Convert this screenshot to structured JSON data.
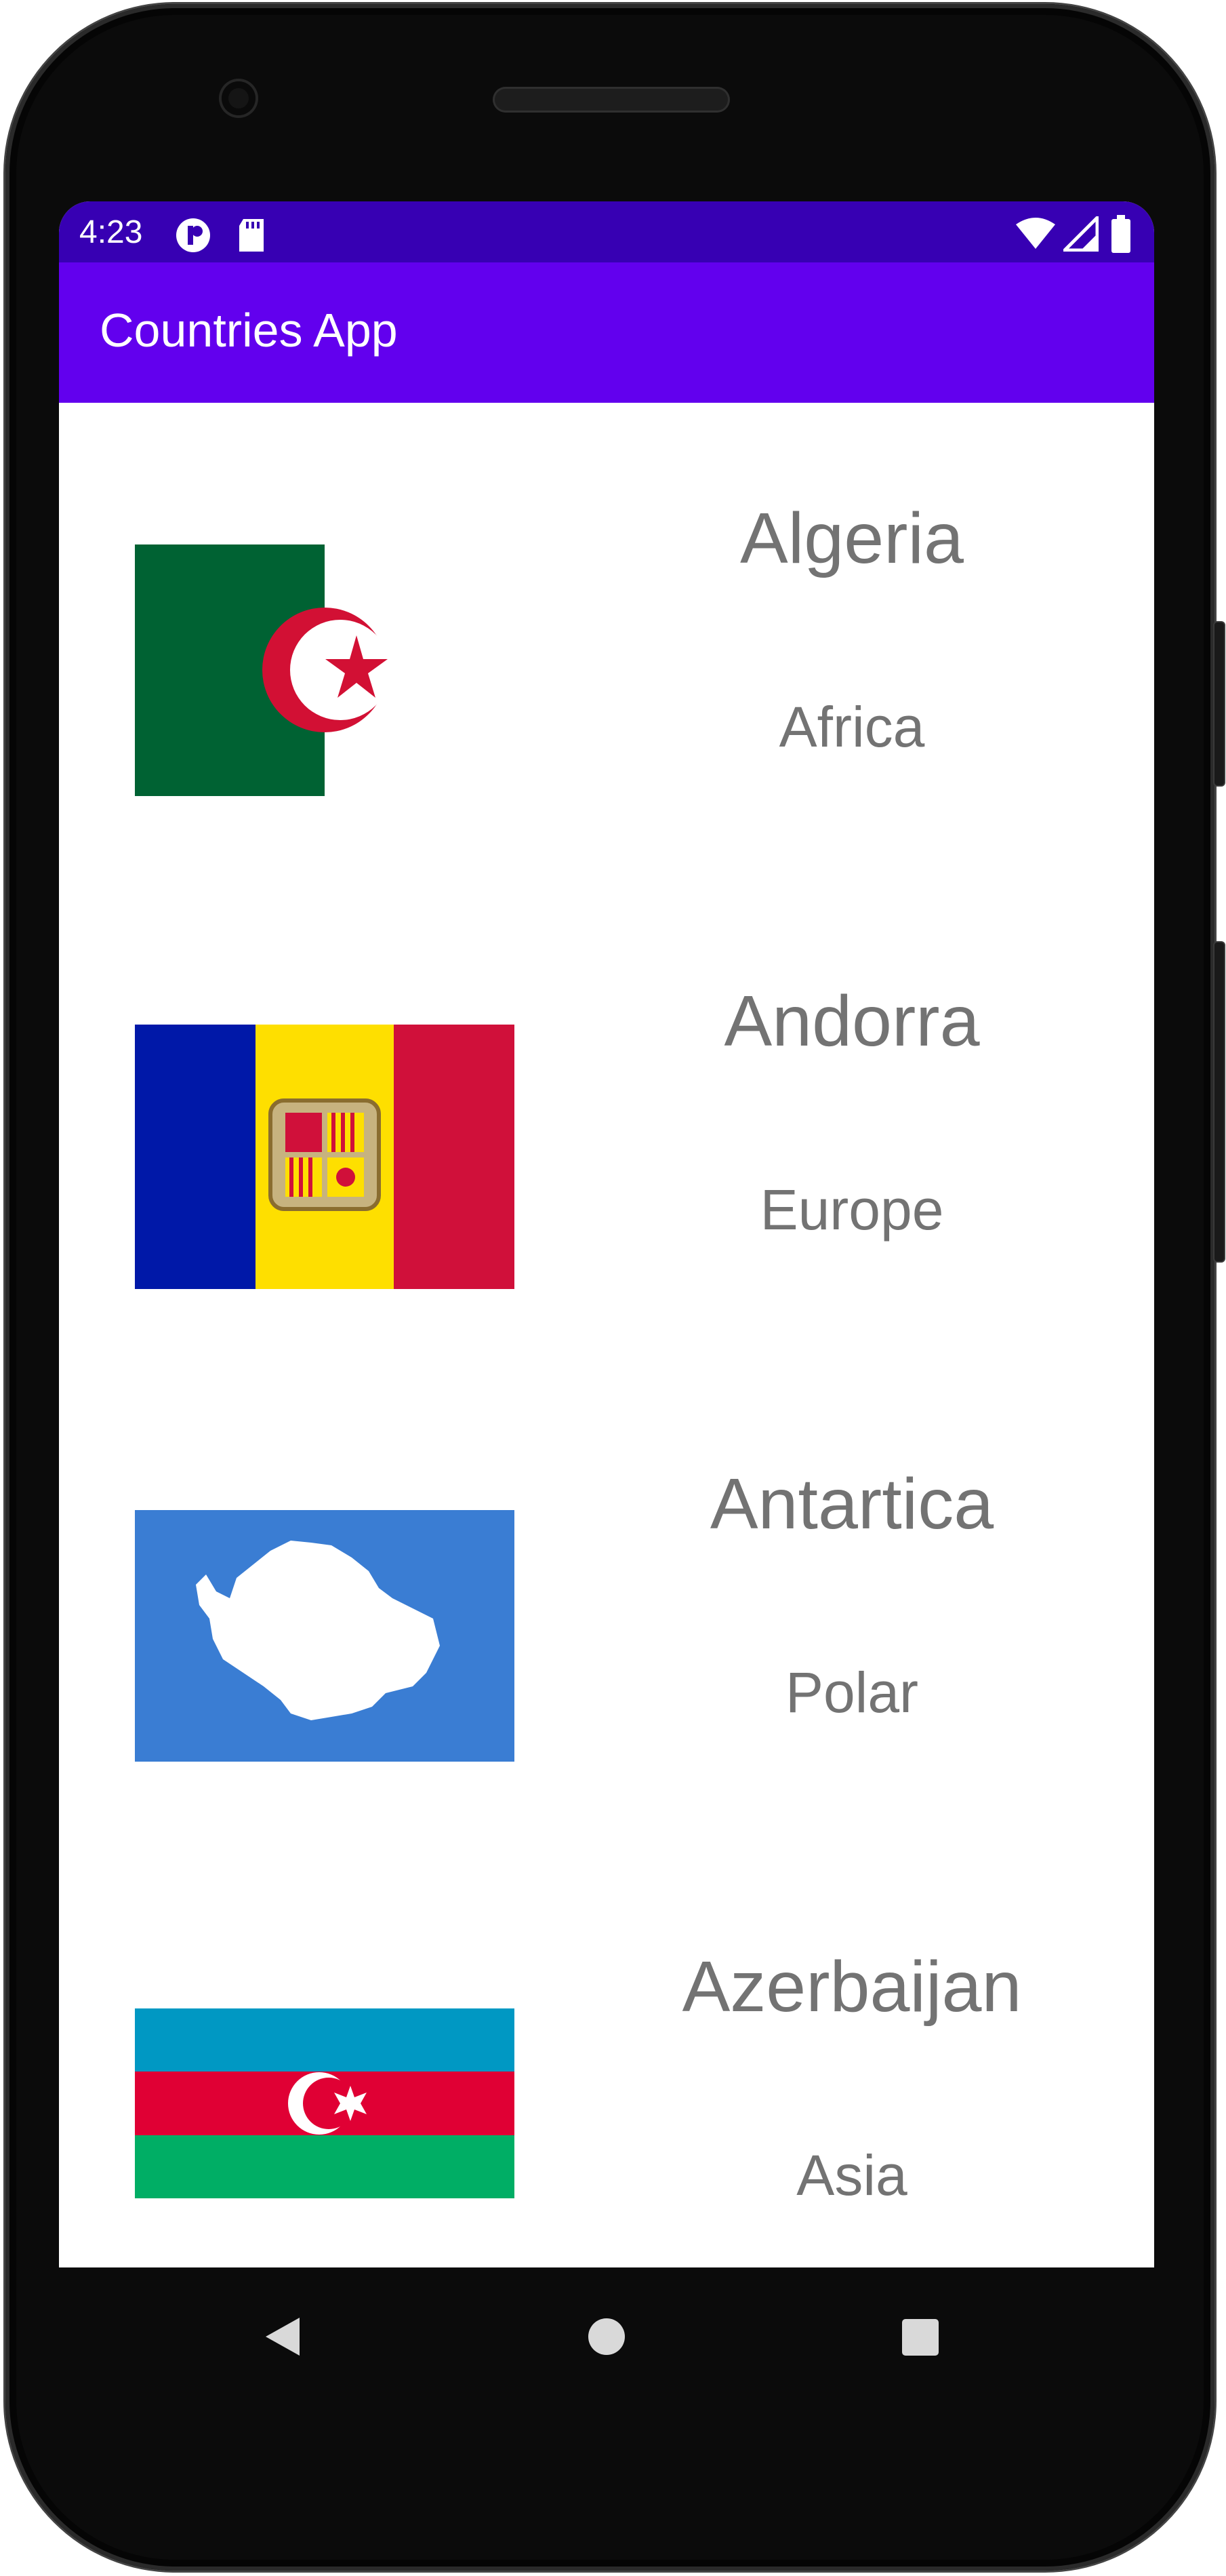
{
  "status_bar": {
    "time": "4:23",
    "bg_color": "#3700B3",
    "left_icons": [
      "notification-icon",
      "sd-card-icon"
    ],
    "right_icons": [
      "wifi-icon",
      "cellular-signal-icon",
      "battery-icon"
    ]
  },
  "app_bar": {
    "title": "Countries App",
    "bg_color": "#6200EE"
  },
  "countries": [
    {
      "name": "Algeria",
      "continent": "Africa",
      "flag": "algeria-flag-icon"
    },
    {
      "name": "Andorra",
      "continent": "Europe",
      "flag": "andorra-flag-icon"
    },
    {
      "name": "Antartica",
      "continent": "Polar",
      "flag": "antarctica-flag-icon"
    },
    {
      "name": "Azerbaijan",
      "continent": "Asia",
      "flag": "azerbaijan-flag-icon"
    }
  ],
  "nav_bar": {
    "buttons": [
      "back-icon",
      "home-icon",
      "recents-icon"
    ]
  },
  "colors": {
    "text_gray": "#737373",
    "algeria_green": "#006233",
    "algeria_red": "#D21034",
    "andorra_blue": "#0018A8",
    "andorra_yellow": "#FEDF00",
    "andorra_red": "#D0103A",
    "antarctica_blue": "#3A7DD3",
    "azerbaijan_blue": "#0098C3",
    "azerbaijan_red": "#E00034",
    "azerbaijan_green": "#00AE65"
  }
}
